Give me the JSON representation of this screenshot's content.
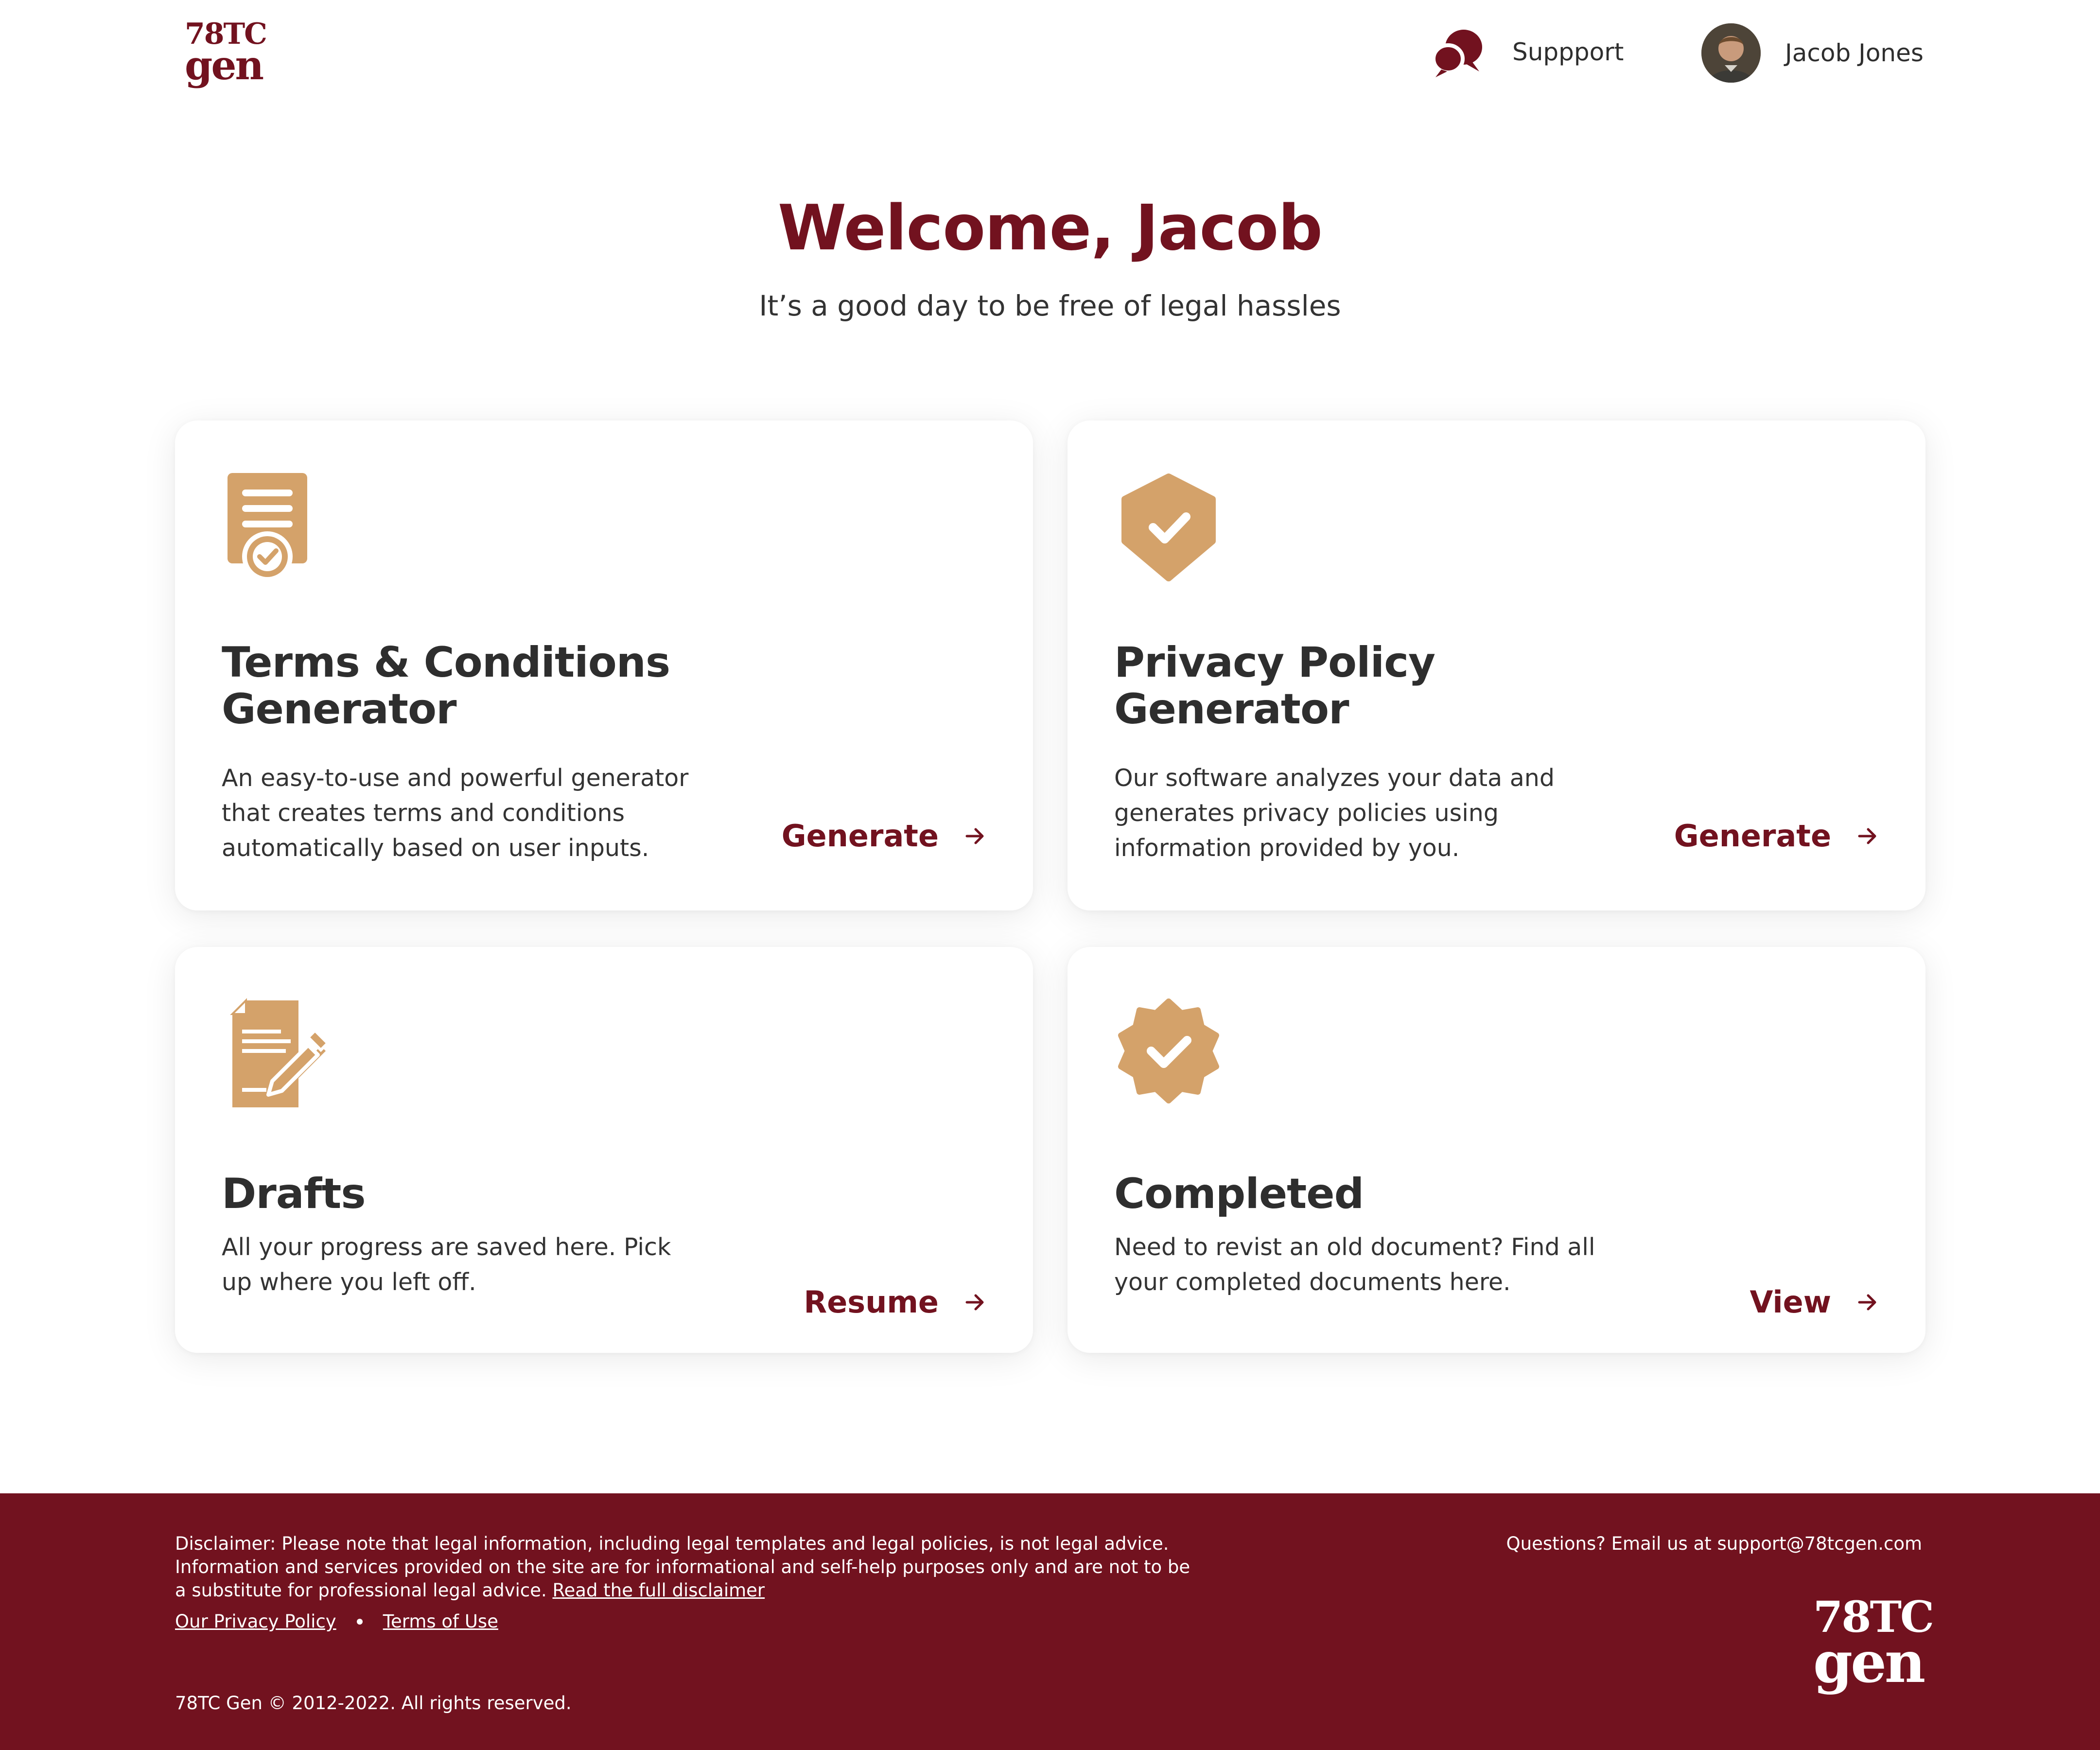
{
  "header": {
    "logo_line1": "78TC",
    "logo_line2": "gen",
    "support_label": "Suppport",
    "user_name": "Jacob Jones"
  },
  "hero": {
    "title": "Welcome, Jacob",
    "subtitle": "It’s a good day to be free of legal hassles"
  },
  "cards": [
    {
      "icon": "certificate-document-icon",
      "title": "Terms & Conditions Generator",
      "description": "An easy-to-use and powerful generator that creates terms and conditions automatically based on user inputs.",
      "action": "Generate"
    },
    {
      "icon": "shield-check-icon",
      "title": "Privacy Policy Generator",
      "description": "Our software analyzes your data and generates privacy policies using information provided by you.",
      "action": "Generate"
    },
    {
      "icon": "document-edit-icon",
      "title": "Drafts",
      "description": "All your progress are saved here. Pick up where you left off.",
      "action": "Resume"
    },
    {
      "icon": "badge-check-icon",
      "title": "Completed",
      "description": "Need to revist an old document? Find all your completed documents here.",
      "action": "View"
    }
  ],
  "footer": {
    "disclaimer_text": "Disclaimer: Please note that legal information, including legal templates and legal policies, is not legal advice. Information and services provided on the site are for informational and self-help purposes only and are not to be a substitute for professional legal advice.",
    "disclaimer_link": "Read the full disclaimer",
    "questions": "Questions? Email us at support@78tcgen.com",
    "privacy_link": "Our Privacy Policy",
    "terms_link": "Terms of Use",
    "copyright": "78TC Gen © 2012-2022. All rights reserved.",
    "logo_line1": "78TC",
    "logo_line2": "gen"
  },
  "colors": {
    "brand": "#72121f",
    "icon_accent": "#d4a26a",
    "text": "#2e2e2e"
  }
}
